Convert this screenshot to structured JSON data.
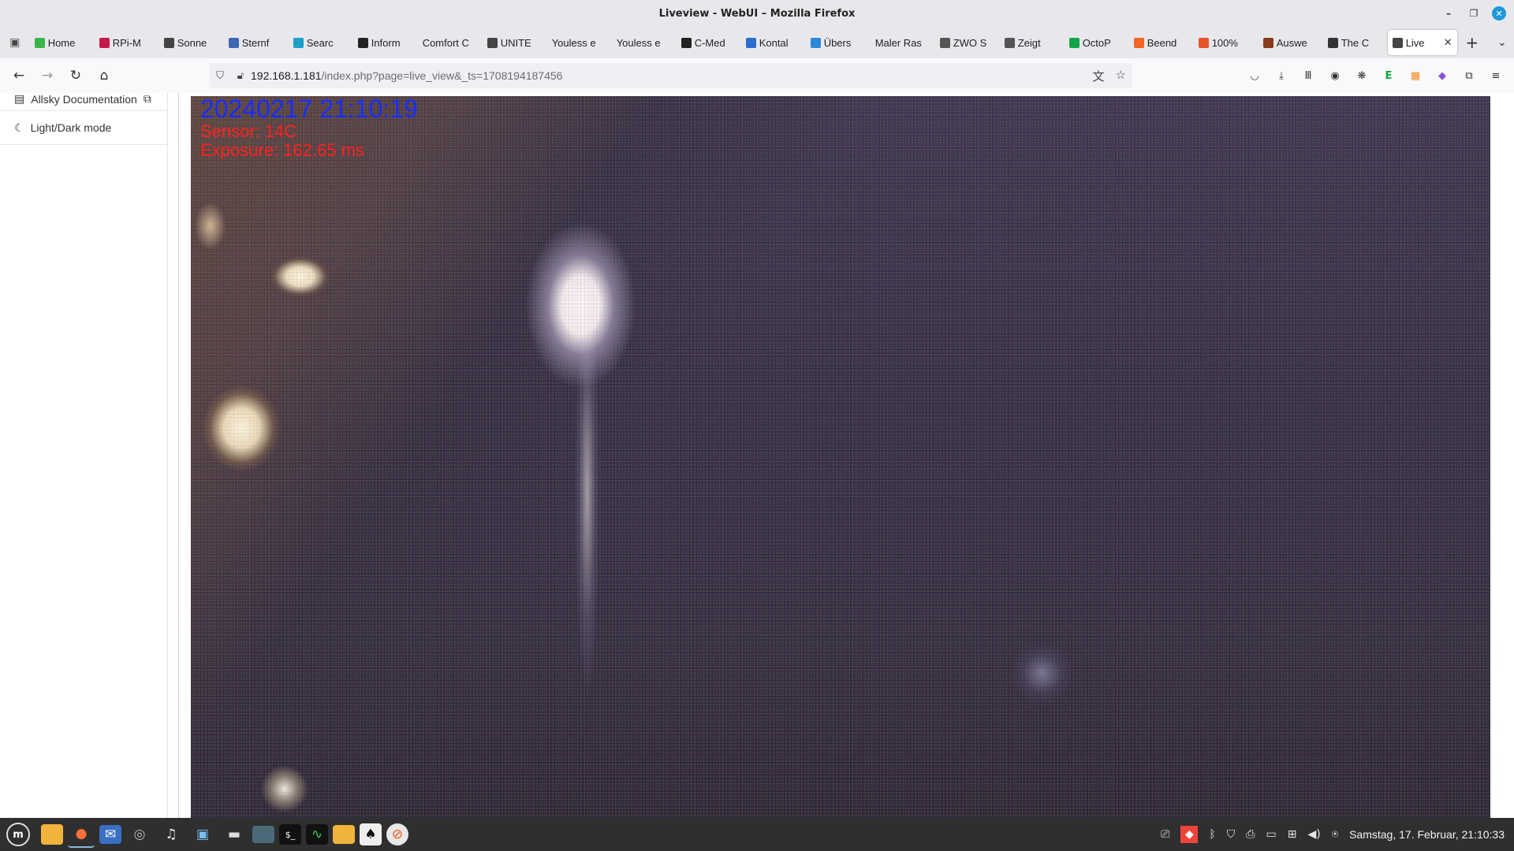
{
  "window": {
    "title": "Liveview - WebUI – Mozilla Firefox",
    "controls": {
      "minimize": "–",
      "maximize": "❐",
      "close": "✕"
    }
  },
  "tabs": [
    {
      "label": "Home",
      "color": "#3bb54a"
    },
    {
      "label": "RPi-M",
      "color": "#c51a4a"
    },
    {
      "label": "Sonne",
      "color": "#444444"
    },
    {
      "label": "Sternf",
      "color": "#3b67b5"
    },
    {
      "label": "Searc",
      "color": "#1aa0c9"
    },
    {
      "label": "Inform",
      "color": "#222222"
    },
    {
      "label": "Comfort C",
      "color": ""
    },
    {
      "label": "UNITE",
      "color": "#444444"
    },
    {
      "label": "Youless e",
      "color": ""
    },
    {
      "label": "Youless e",
      "color": ""
    },
    {
      "label": "C-Med",
      "color": "#222222"
    },
    {
      "label": "Kontal",
      "color": "#2a6ccf"
    },
    {
      "label": "Übers",
      "color": "#2b8ad8"
    },
    {
      "label": "Maler Ras",
      "color": ""
    },
    {
      "label": "ZWO S",
      "color": "#555555"
    },
    {
      "label": "Zeigt",
      "color": "#555555"
    },
    {
      "label": "OctoP",
      "color": "#13a44b"
    },
    {
      "label": "Beend",
      "color": "#f26522"
    },
    {
      "label": "100%",
      "color": "#e8542a"
    },
    {
      "label": "Auswe",
      "color": "#8b3a1a"
    },
    {
      "label": "The C",
      "color": "#333333"
    },
    {
      "label": "Live",
      "color": "#444444",
      "active": true
    }
  ],
  "nav": {
    "url_host": "192.168.1.181",
    "url_path": "/index.php?page=live_view&_ts=1708194187456"
  },
  "sidebar": {
    "items": [
      {
        "label": "Allsky Documentation"
      },
      {
        "label": "Light/Dark mode"
      }
    ]
  },
  "liveview": {
    "date": "20240217  21:10:19",
    "sensor": "Sensor:   14C",
    "exposure": "Exposure: 162.65 ms"
  },
  "taskbar": {
    "clock": "Samstag, 17. Februar, 21:10:33"
  }
}
